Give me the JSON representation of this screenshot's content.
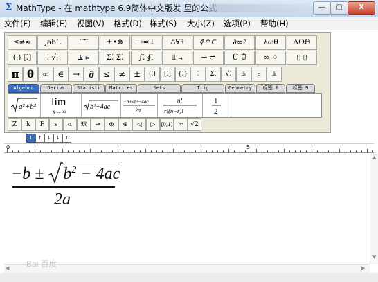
{
  "window": {
    "title": "MathType - 在 mathtype 6.9简体中文版发 里的公式",
    "minimize": "—",
    "maximize": "□",
    "close": "X"
  },
  "menu": [
    "文件(F)",
    "编辑(E)",
    "视图(V)",
    "格式(D)",
    "样式(S)",
    "大小(Z)",
    "选项(P)",
    "帮助(H)"
  ],
  "palette": {
    "row1": [
      "≤≠≈",
      "¸ab˙.",
      "¨ ⃗ ⃡",
      "±•⊗",
      "→⇔↓",
      "∴∀∃",
      "∉∩⊂",
      "∂∞ℓ",
      "λωθ",
      "ΛΩΘ"
    ],
    "row2": [
      "(⁚) [⁚]",
      "⁚ √⁚",
      "⫡ ⫢",
      "Σ⁚ Σ⁚",
      "∫⁚ ∮⁚",
      "⫫ ⫬",
      "→ ⇌",
      "Ū Ů",
      "∞ ⁘",
      "▯ ▯"
    ],
    "row3": [
      "π",
      "θ",
      "∞",
      "∈",
      "→",
      "∂",
      "≤",
      "≠",
      "±",
      "(⁚)",
      "[⁚]",
      "{⁚}",
      "⁚",
      "Σ⁚",
      "√⁚",
      "⫡",
      "⫢",
      "⫡"
    ],
    "tabs": [
      "Algebra",
      "Derivs",
      "Statisti",
      "Matrices",
      "Sets",
      "Trig",
      "Geometry",
      "标签 8",
      "标签 9"
    ],
    "templates": [
      "√a²+b²",
      "lim x→∞",
      "√b²−4ac",
      "−b±√b²−4ac / 2a",
      "n! / r!(n−r)!",
      "1/2"
    ],
    "row5": [
      "Z",
      "k",
      "F",
      "s",
      "α",
      "𝔐",
      "⊸",
      "⊗",
      "⊕",
      "◁",
      "▷",
      "[0,1]",
      "∞",
      "√2"
    ]
  },
  "size_buttons": [
    "1",
    "↑",
    "↓",
    "↓",
    "↑"
  ],
  "ruler": {
    "label_0": "0",
    "label_5": "5"
  },
  "formula": {
    "numerator": "−b ± √b² − 4ac",
    "denominator": "2a"
  },
  "watermark": "Bai 百度"
}
